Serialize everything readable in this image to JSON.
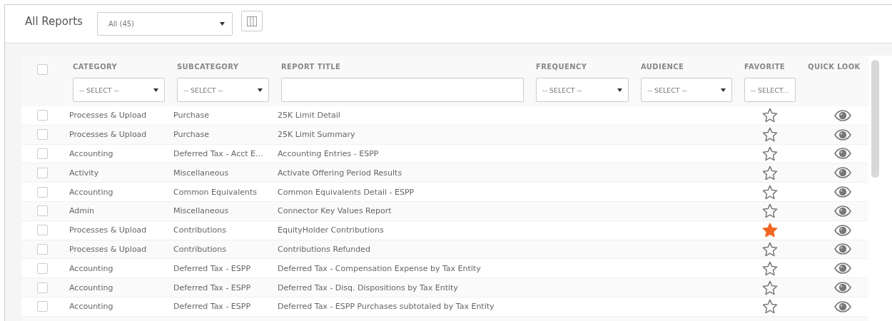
{
  "header": {
    "title": "All Reports",
    "view_select": {
      "value": "All (45)"
    }
  },
  "table": {
    "select_all": {
      "checked": false
    },
    "columns": [
      {
        "label": "CATEGORY",
        "filter": {
          "kind": "select",
          "value": "-- SELECT --"
        }
      },
      {
        "label": "SUBCATEGORY",
        "filter": {
          "kind": "select",
          "value": "-- SELECT --"
        }
      },
      {
        "label": "REPORT TITLE",
        "filter": {
          "kind": "text"
        }
      },
      {
        "label": "FREQUENCY",
        "filter": {
          "kind": "select",
          "value": "-- SELECT --"
        }
      },
      {
        "label": "AUDIENCE",
        "filter": {
          "kind": "select",
          "value": "-- SELECT --"
        }
      },
      {
        "label": "FAVORITE",
        "filter": {
          "kind": "select",
          "value": "-- SELECT..."
        }
      },
      {
        "label": "QUICK LOOK"
      }
    ],
    "rows": [
      {
        "checked": false,
        "category": "Processes & Upload",
        "subcategory": "Purchase",
        "title": "25K Limit Detail",
        "favorite": false
      },
      {
        "checked": false,
        "category": "Processes & Upload",
        "subcategory": "Purchase",
        "title": "25K Limit Summary",
        "favorite": false
      },
      {
        "checked": false,
        "category": "Accounting",
        "subcategory": "Deferred Tax - Acct E...",
        "title": "Accounting Entries - ESPP",
        "favorite": false
      },
      {
        "checked": false,
        "category": "Activity",
        "subcategory": "Miscellaneous",
        "title": "Activate Offering Period Results",
        "favorite": false
      },
      {
        "checked": false,
        "category": "Accounting",
        "subcategory": "Common Equivalents",
        "title": "Common Equivalents Detail - ESPP",
        "favorite": false
      },
      {
        "checked": false,
        "category": "Admin",
        "subcategory": "Miscellaneous",
        "title": "Connector Key Values Report",
        "favorite": false
      },
      {
        "checked": false,
        "category": "Processes & Upload",
        "subcategory": "Contributions",
        "title": "EquityHolder Contributions",
        "favorite": true
      },
      {
        "checked": false,
        "category": "Processes & Upload",
        "subcategory": "Contributions",
        "title": "Contributions Refunded",
        "favorite": false
      },
      {
        "checked": false,
        "category": "Accounting",
        "subcategory": "Deferred Tax - ESPP",
        "title": "Deferred Tax - Compensation Expense by Tax Entity",
        "favorite": false
      },
      {
        "checked": false,
        "category": "Accounting",
        "subcategory": "Deferred Tax - ESPP",
        "title": "Deferred Tax - Disq. Dispositions by Tax Entity",
        "favorite": false
      },
      {
        "checked": false,
        "category": "Accounting",
        "subcategory": "Deferred Tax - ESPP",
        "title": "Deferred Tax - ESPP Purchases subtotaled by Tax Entity",
        "favorite": false
      }
    ]
  }
}
